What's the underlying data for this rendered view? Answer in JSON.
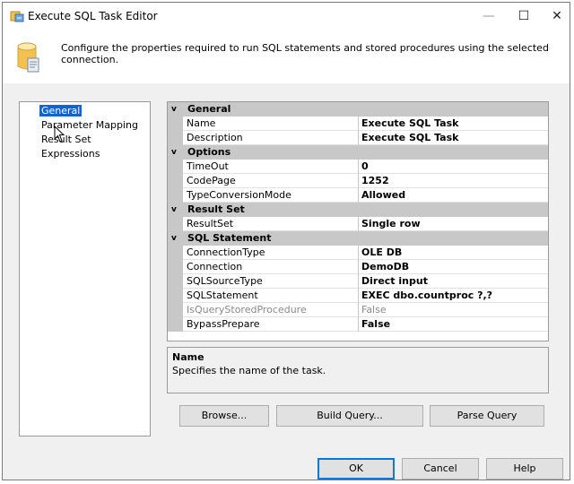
{
  "window": {
    "title": "Execute SQL Task Editor",
    "minimize_glyph": "—",
    "maximize_glyph": "☐",
    "close_glyph": "✕"
  },
  "header": {
    "text": "Configure the properties required to run SQL statements and stored procedures using the selected connection."
  },
  "nav": {
    "items": [
      {
        "label": "General",
        "selected": true
      },
      {
        "label": "Parameter Mapping",
        "selected": false
      },
      {
        "label": "Result Set",
        "selected": false
      },
      {
        "label": "Expressions",
        "selected": false
      }
    ]
  },
  "grid": {
    "expand_glyph": "v",
    "categories": [
      {
        "name": "General",
        "props": [
          {
            "name": "Name",
            "value": "Execute SQL Task"
          },
          {
            "name": "Description",
            "value": "Execute SQL Task"
          }
        ]
      },
      {
        "name": "Options",
        "props": [
          {
            "name": "TimeOut",
            "value": "0"
          },
          {
            "name": "CodePage",
            "value": "1252"
          },
          {
            "name": "TypeConversionMode",
            "value": "Allowed"
          }
        ]
      },
      {
        "name": "Result Set",
        "props": [
          {
            "name": "ResultSet",
            "value": "Single row"
          }
        ]
      },
      {
        "name": "SQL Statement",
        "props": [
          {
            "name": "ConnectionType",
            "value": "OLE DB"
          },
          {
            "name": "Connection",
            "value": "DemoDB"
          },
          {
            "name": "SQLSourceType",
            "value": "Direct input"
          },
          {
            "name": "SQLStatement",
            "value": "EXEC dbo.countproc ?,?"
          },
          {
            "name": "IsQueryStoredProcedure",
            "value": "False",
            "disabled": true
          },
          {
            "name": "BypassPrepare",
            "value": "False"
          }
        ]
      }
    ]
  },
  "description": {
    "title": "Name",
    "text": "Specifies the name of the task."
  },
  "buttons": {
    "browse": "Browse...",
    "build_query": "Build Query...",
    "parse_query": "Parse Query",
    "ok": "OK",
    "cancel": "Cancel",
    "help": "Help"
  },
  "colors": {
    "selection": "#0a64d2",
    "category_bg": "#c8c8c8",
    "default_button_border": "#0078d7"
  }
}
